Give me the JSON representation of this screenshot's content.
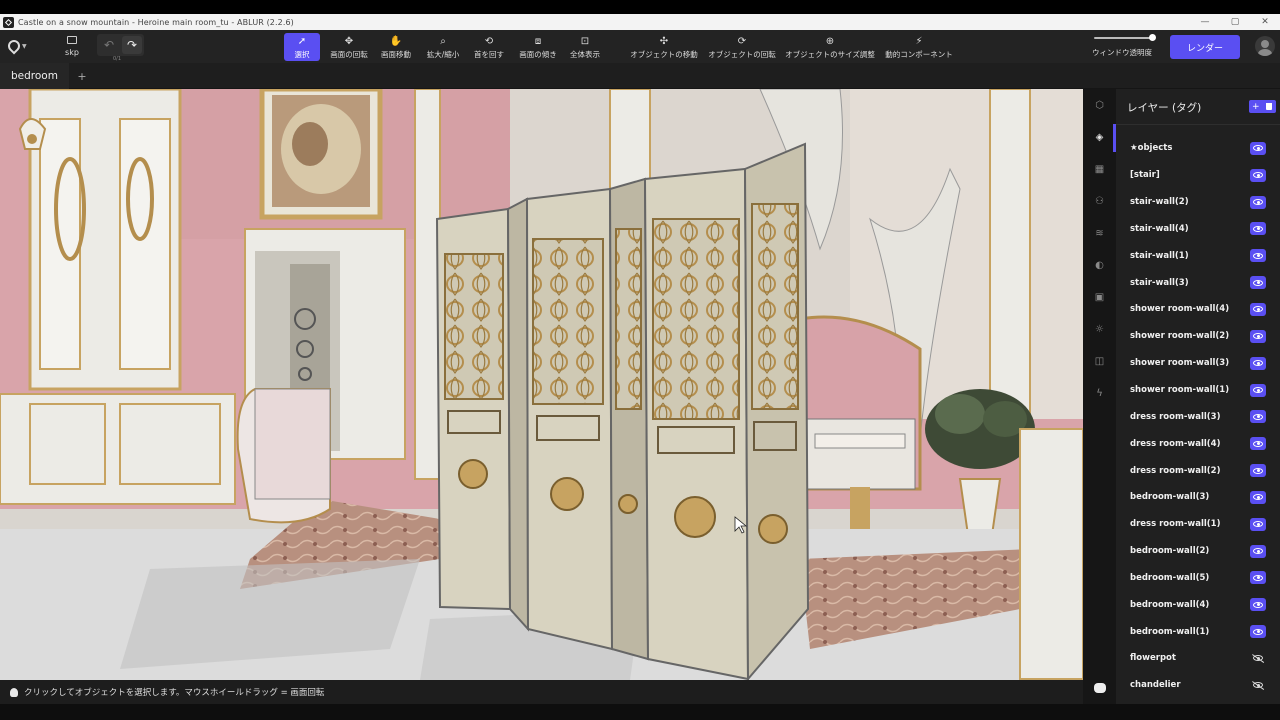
{
  "window": {
    "title": "Castle on a snow mountain - Heroine main room_tu - ABLUR (2.2.6)",
    "controls": [
      "—",
      "▢",
      "✕"
    ]
  },
  "toolbar": {
    "file_label": "skp",
    "undo_counter": "0/1",
    "tools": [
      {
        "label": "選択",
        "icon": "cursor-icon",
        "glyph": "➚",
        "active": true
      },
      {
        "label": "画面の回転",
        "icon": "orbit-icon",
        "glyph": "✥",
        "active": false
      },
      {
        "label": "画面移動",
        "icon": "pan-hand-icon",
        "glyph": "✋",
        "active": false
      },
      {
        "label": "拡大/縮小",
        "icon": "zoom-icon",
        "glyph": "⌕",
        "active": false
      },
      {
        "label": "首を回す",
        "icon": "look-around-icon",
        "glyph": "⟲",
        "active": false
      },
      {
        "label": "画面の傾き",
        "icon": "tilt-icon",
        "glyph": "⧈",
        "active": false
      },
      {
        "label": "全体表示",
        "icon": "zoom-extents-icon",
        "glyph": "⊡",
        "active": false
      },
      {
        "label": "オブジェクトの移動",
        "icon": "move-object-icon",
        "glyph": "✣",
        "active": false
      },
      {
        "label": "オブジェクトの回転",
        "icon": "rotate-object-icon",
        "glyph": "⟳",
        "active": false
      },
      {
        "label": "オブジェクトのサイズ調整",
        "icon": "scale-object-icon",
        "glyph": "⊕",
        "active": false
      },
      {
        "label": "動的コンポーネント",
        "icon": "dynamic-component-icon",
        "glyph": "⚡",
        "active": false
      }
    ],
    "window_opacity_label": "ウィンドウ透明度",
    "window_opacity": 0.95,
    "render_label": "レンダー"
  },
  "tabs": {
    "scene": "bedroom",
    "add": "+"
  },
  "status": {
    "hint": "クリックしてオブジェクトを選択します。マウスホイールドラッグ = 画面回転"
  },
  "panel": {
    "title": "レイヤー (タグ)",
    "add_label": "+",
    "layers": [
      {
        "name": "★objects",
        "visible": true
      },
      {
        "name": "[stair]",
        "visible": true
      },
      {
        "name": "stair-wall(2)",
        "visible": true
      },
      {
        "name": "stair-wall(4)",
        "visible": true
      },
      {
        "name": "stair-wall(1)",
        "visible": true
      },
      {
        "name": "stair-wall(3)",
        "visible": true
      },
      {
        "name": "shower room-wall(4)",
        "visible": true
      },
      {
        "name": "shower room-wall(2)",
        "visible": true
      },
      {
        "name": "shower room-wall(3)",
        "visible": true
      },
      {
        "name": "shower room-wall(1)",
        "visible": true
      },
      {
        "name": "dress room-wall(3)",
        "visible": true
      },
      {
        "name": "dress room-wall(4)",
        "visible": true
      },
      {
        "name": "dress room-wall(2)",
        "visible": true
      },
      {
        "name": "bedroom-wall(3)",
        "visible": true
      },
      {
        "name": "dress room-wall(1)",
        "visible": true
      },
      {
        "name": "bedroom-wall(2)",
        "visible": true
      },
      {
        "name": "bedroom-wall(5)",
        "visible": true
      },
      {
        "name": "bedroom-wall(4)",
        "visible": true
      },
      {
        "name": "bedroom-wall(1)",
        "visible": true
      },
      {
        "name": "flowerpot",
        "visible": false
      },
      {
        "name": "chandelier",
        "visible": false
      }
    ]
  },
  "colors": {
    "accent": "#5a4ff2",
    "wall_pink": "#d8a3a8",
    "panel_white": "#ecebe6",
    "gold": "#c7a361",
    "floor": "#dcdcdc",
    "carpet": "#b88a7c"
  }
}
